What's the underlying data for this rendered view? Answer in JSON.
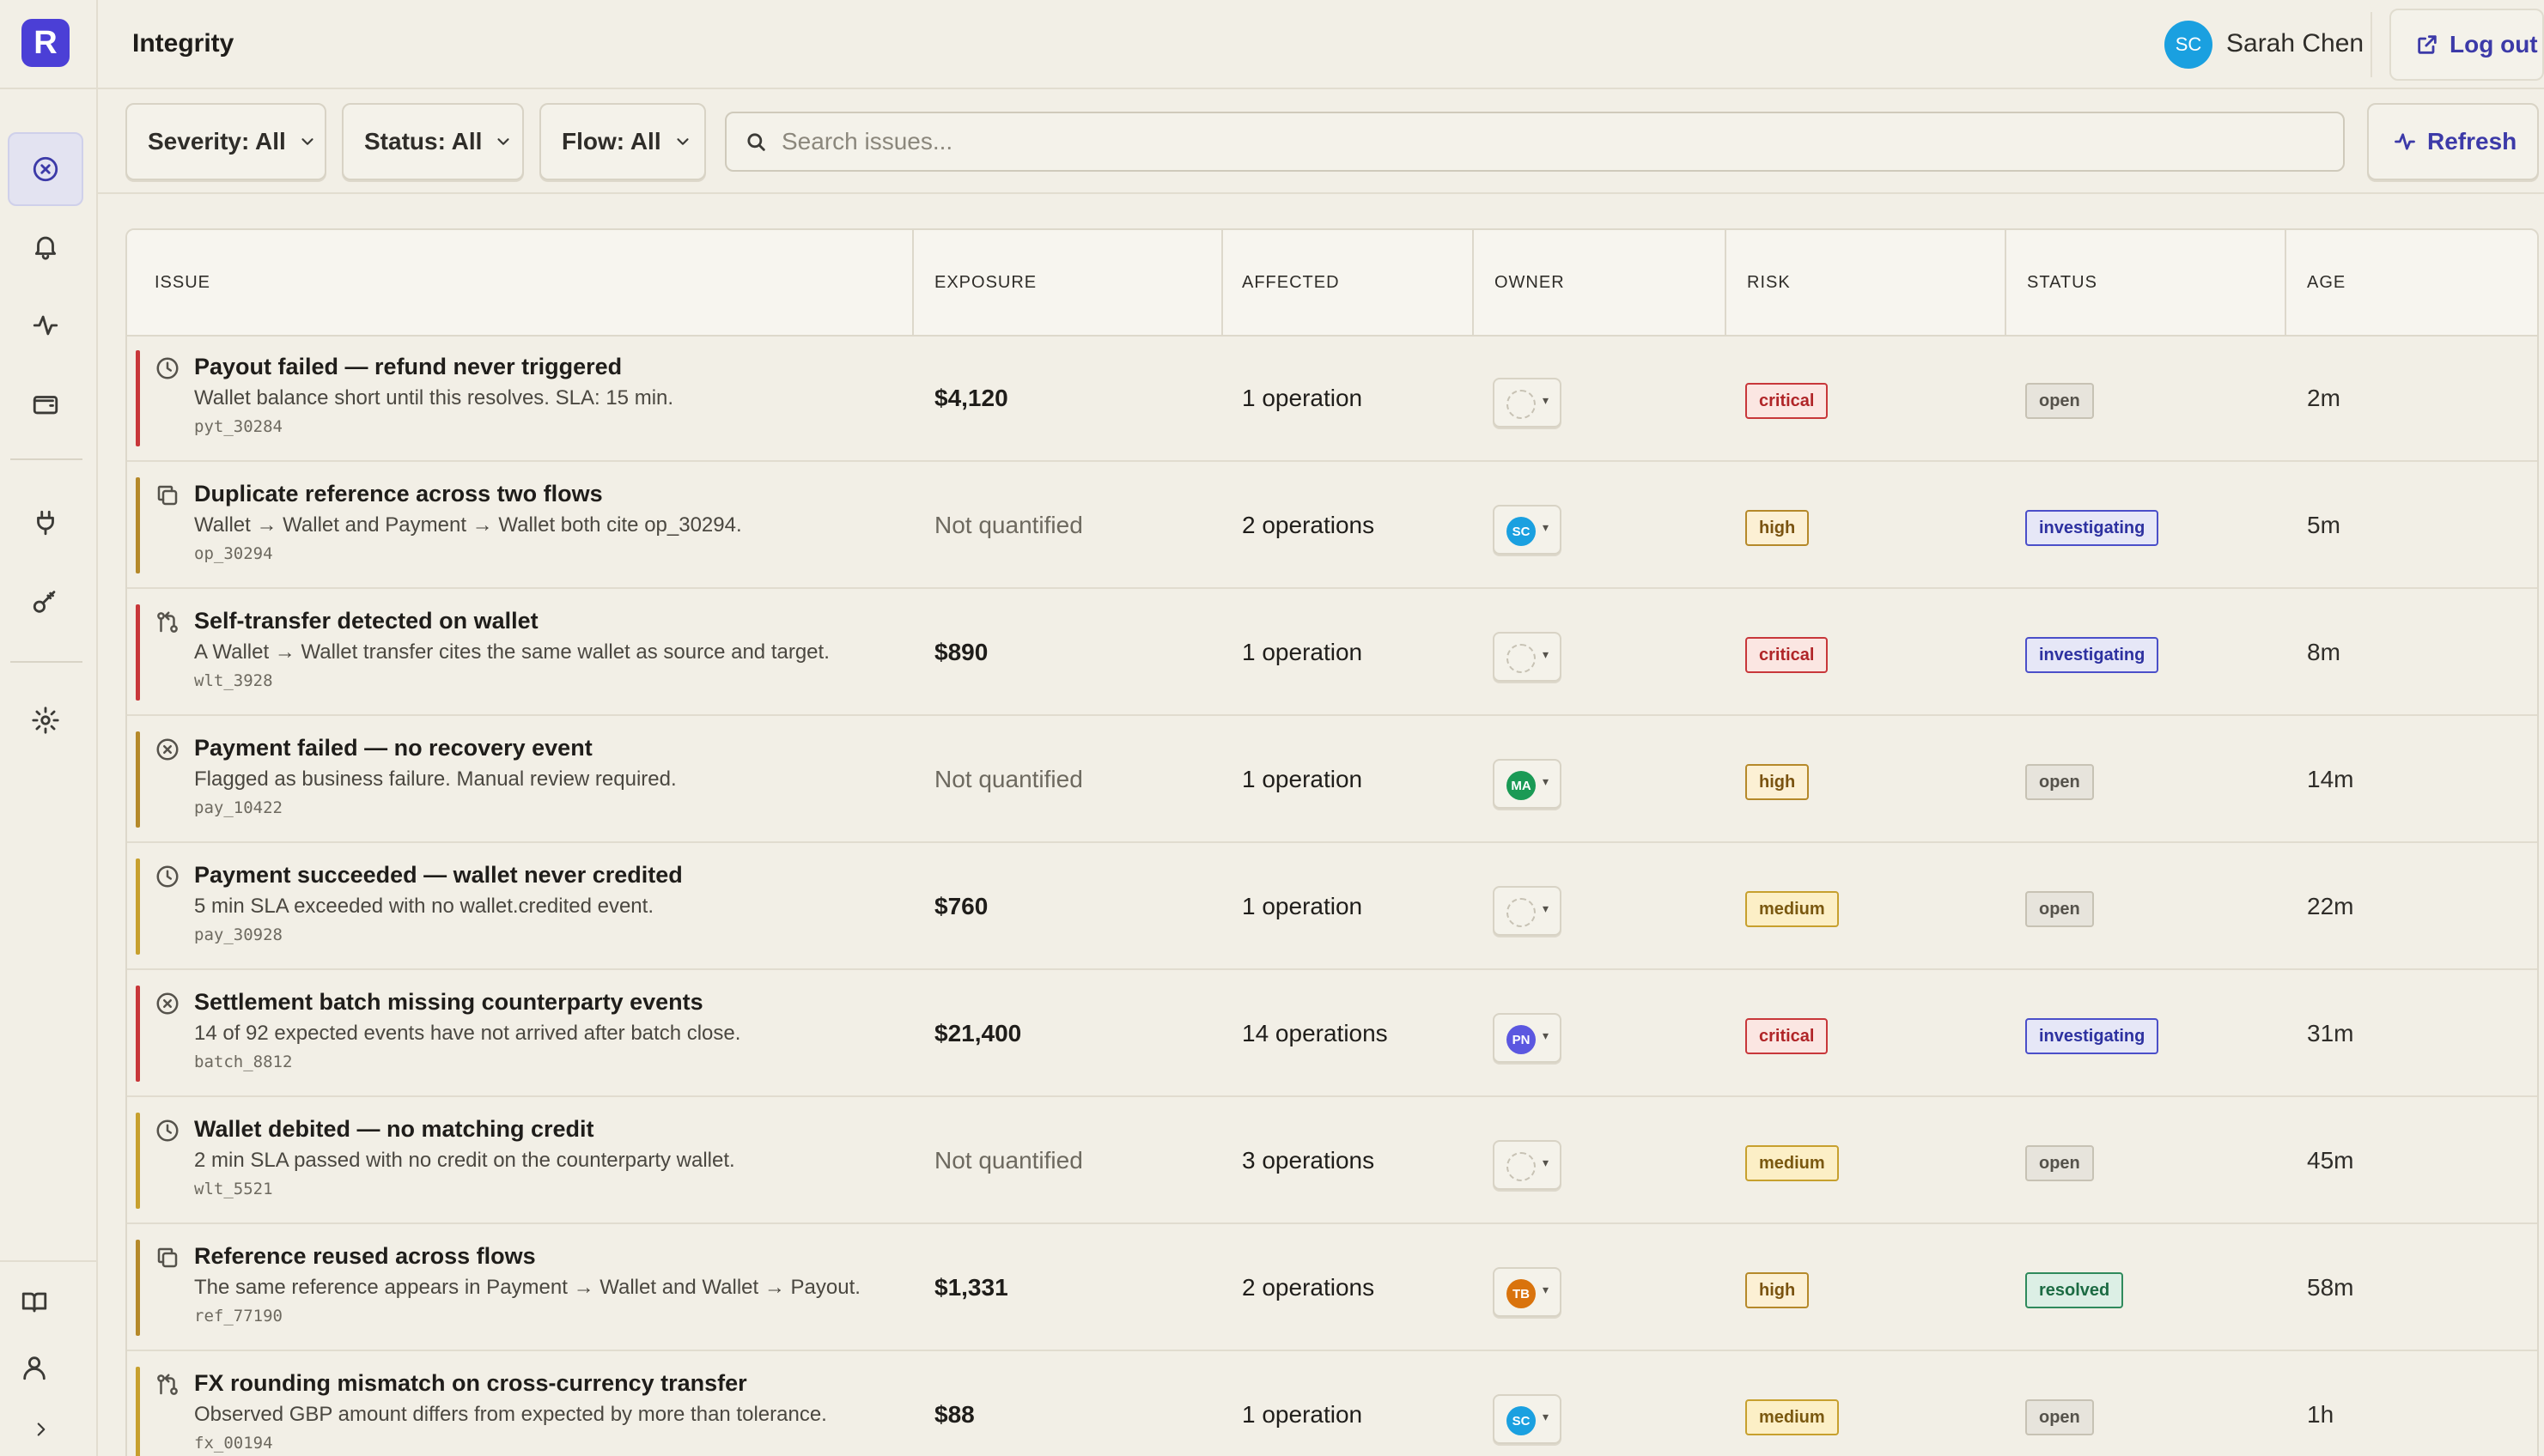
{
  "app": {
    "logo_letter": "R",
    "page_title": "Integrity"
  },
  "user": {
    "initials": "SC",
    "name": "Sarah Chen",
    "logout_label": "Log out"
  },
  "sidebar": {
    "nav": [
      {
        "icon": "circle-x-icon",
        "active": true
      },
      {
        "icon": "bell-icon",
        "active": false
      },
      {
        "icon": "activity-icon",
        "active": false
      },
      {
        "icon": "wallet-icon",
        "active": false
      },
      {
        "icon": "plug-icon",
        "active": false
      },
      {
        "icon": "key-icon",
        "active": false
      },
      {
        "icon": "gear-icon",
        "active": false
      }
    ],
    "bottom": [
      {
        "icon": "book-icon"
      },
      {
        "icon": "user-icon"
      },
      {
        "icon": "chevron-right-icon"
      }
    ]
  },
  "toolbar": {
    "severity_label": "Severity: All",
    "status_label": "Status: All",
    "flow_label": "Flow: All",
    "search_placeholder": "Search issues...",
    "refresh_label": "Refresh"
  },
  "table": {
    "headers": [
      "ISSUE",
      "EXPOSURE",
      "AFFECTED",
      "OWNER",
      "RISK",
      "STATUS",
      "AGE"
    ],
    "rows": [
      {
        "icon": "clock-icon",
        "title": "Payout failed — refund never triggered",
        "desc": "Wallet balance short until this resolves. SLA: 15 min.",
        "ref": "pyt_30284",
        "exposure": "$4,120",
        "affected": "1 operation",
        "owner": "",
        "risk": "critical",
        "status": "open",
        "age": "2m"
      },
      {
        "icon": "copy-icon",
        "title": "Duplicate reference across two flows",
        "desc": "Wallet → Wallet and Payment → Wallet both cite op_30294.",
        "ref": "op_30294",
        "exposure": "Not quantified",
        "affected": "2 operations",
        "owner": "SC",
        "risk": "high",
        "status": "investigating",
        "age": "5m"
      },
      {
        "icon": "git-pull-icon",
        "title": "Self-transfer detected on wallet",
        "desc": "A Wallet → Wallet transfer cites the same wallet as source and target.",
        "ref": "wlt_3928",
        "exposure": "$890",
        "affected": "1 operation",
        "owner": "",
        "risk": "critical",
        "status": "investigating",
        "age": "8m"
      },
      {
        "icon": "circle-x-icon",
        "title": "Payment failed — no recovery event",
        "desc": "Flagged as business failure. Manual review required.",
        "ref": "pay_10422",
        "exposure": "Not quantified",
        "affected": "1 operation",
        "owner": "MA",
        "risk": "high",
        "status": "open",
        "age": "14m"
      },
      {
        "icon": "clock-icon",
        "title": "Payment succeeded — wallet never credited",
        "desc": "5 min SLA exceeded with no wallet.credited event.",
        "ref": "pay_30928",
        "exposure": "$760",
        "affected": "1 operation",
        "owner": "",
        "risk": "medium",
        "status": "open",
        "age": "22m"
      },
      {
        "icon": "circle-x-icon",
        "title": "Settlement batch missing counterparty events",
        "desc": "14 of 92 expected events have not arrived after batch close.",
        "ref": "batch_8812",
        "exposure": "$21,400",
        "affected": "14 operations",
        "owner": "PN",
        "risk": "critical",
        "status": "investigating",
        "age": "31m"
      },
      {
        "icon": "clock-icon",
        "title": "Wallet debited — no matching credit",
        "desc": "2 min SLA passed with no credit on the counterparty wallet.",
        "ref": "wlt_5521",
        "exposure": "Not quantified",
        "affected": "3 operations",
        "owner": "",
        "risk": "medium",
        "status": "open",
        "age": "45m"
      },
      {
        "icon": "copy-icon",
        "title": "Reference reused across flows",
        "desc": "The same reference appears in Payment → Wallet and Wallet → Payout.",
        "ref": "ref_77190",
        "exposure": "$1,331",
        "affected": "2 operations",
        "owner": "TB",
        "risk": "high",
        "status": "resolved",
        "age": "58m"
      },
      {
        "icon": "git-pull-icon",
        "title": "FX rounding mismatch on cross-currency transfer",
        "desc": "Observed GBP amount differs from expected by more than tolerance.",
        "ref": "fx_00194",
        "exposure": "$88",
        "affected": "1 operation",
        "owner": "SC",
        "risk": "medium",
        "status": "open",
        "age": "1h"
      }
    ]
  },
  "colors": {
    "accent": "#4b3fd6",
    "critical": "#c8373a",
    "high": "#b5892a",
    "medium": "#c7a02e",
    "owner_SC": "#1aa0e0",
    "owner_MA": "#1a9a55",
    "owner_PN": "#5b57e0",
    "owner_TB": "#d9730d"
  }
}
